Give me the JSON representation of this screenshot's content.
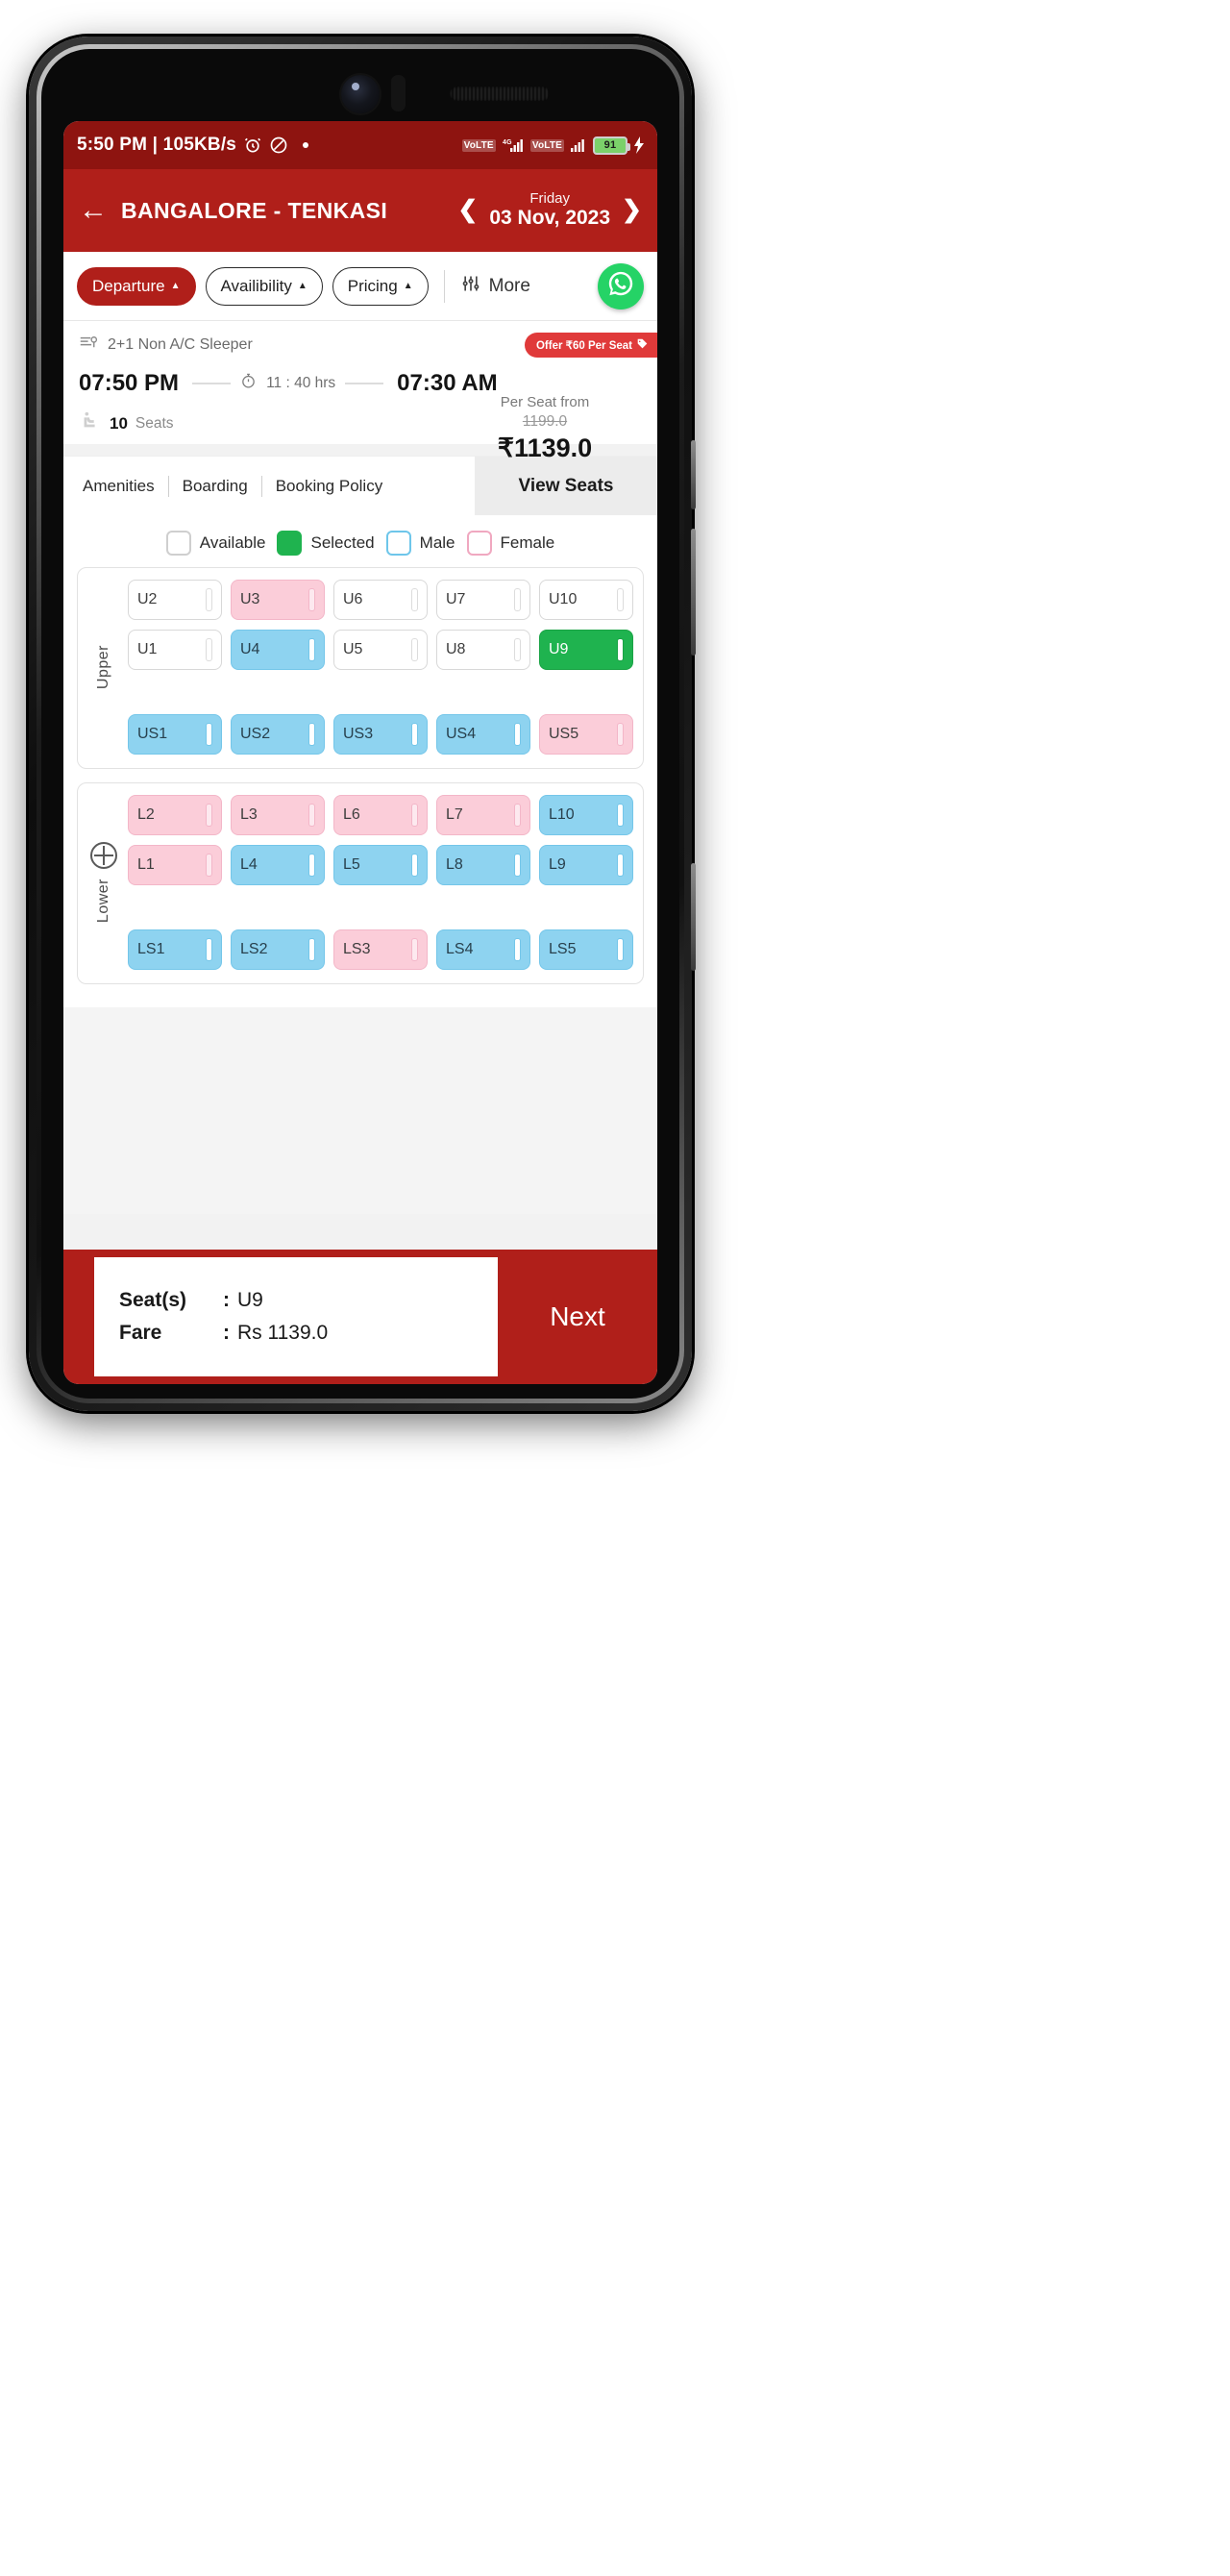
{
  "status_bar": {
    "time_and_speed": "5:50 PM | 105KB/s",
    "alarm_icon": "alarm-clock-icon",
    "dnd_icon": "do-not-disturb-icon",
    "network_badge_1": "VoLTE",
    "network_type": "4G",
    "network_badge_2": "VoLTE",
    "battery_percent": "91",
    "charging_icon": "charging-bolt-icon"
  },
  "header": {
    "back_icon": "back-arrow-icon",
    "route_title": "BANGALORE - TENKASI",
    "prev_icon": "chevron-left-icon",
    "next_icon": "chevron-right-icon",
    "day_label": "Friday",
    "date_label": "03 Nov, 2023"
  },
  "filters": {
    "chips": [
      {
        "label": "Departure",
        "active": true
      },
      {
        "label": "Availibility",
        "active": false
      },
      {
        "label": "Pricing",
        "active": false
      }
    ],
    "more_label": "More",
    "more_icon": "filter-sliders-icon",
    "whatsapp_icon": "whatsapp-icon"
  },
  "bus": {
    "bus_icon": "bus-icon",
    "bus_type": "2+1 Non A/C Sleeper",
    "offer_badge": "Offer ₹60 Per Seat",
    "offer_tag_icon": "tag-icon",
    "departure_time": "07:50 PM",
    "duration_icon": "stopwatch-icon",
    "duration": "11 : 40 hrs",
    "arrival_time": "07:30 AM",
    "seat_icon": "seat-icon",
    "seats_count": "10",
    "seats_word": "Seats",
    "price_label": "Per Seat from",
    "price_original": "1199.0",
    "price_current": "₹1139.0"
  },
  "tabs": {
    "links": [
      "Amenities",
      "Boarding",
      "Booking Policy"
    ],
    "view_seats": "View Seats"
  },
  "legend": [
    {
      "label": "Available",
      "state": "available"
    },
    {
      "label": "Selected",
      "state": "selected"
    },
    {
      "label": "Male",
      "state": "male"
    },
    {
      "label": "Female",
      "state": "female"
    }
  ],
  "decks": [
    {
      "name": "Upper",
      "has_wheel": false,
      "rows": [
        [
          {
            "id": "U2",
            "state": "available"
          },
          {
            "id": "U3",
            "state": "female"
          },
          {
            "id": "U6",
            "state": "available"
          },
          {
            "id": "U7",
            "state": "available"
          },
          {
            "id": "U10",
            "state": "available"
          }
        ],
        [
          {
            "id": "U1",
            "state": "available"
          },
          {
            "id": "U4",
            "state": "male"
          },
          {
            "id": "U5",
            "state": "available"
          },
          {
            "id": "U8",
            "state": "available"
          },
          {
            "id": "U9",
            "state": "selected"
          }
        ],
        [
          {
            "id": "US1",
            "state": "male"
          },
          {
            "id": "US2",
            "state": "male"
          },
          {
            "id": "US3",
            "state": "male"
          },
          {
            "id": "US4",
            "state": "male"
          },
          {
            "id": "US5",
            "state": "female"
          }
        ]
      ]
    },
    {
      "name": "Lower",
      "has_wheel": true,
      "wheel_icon": "steering-wheel-icon",
      "rows": [
        [
          {
            "id": "L2",
            "state": "female"
          },
          {
            "id": "L3",
            "state": "female"
          },
          {
            "id": "L6",
            "state": "female"
          },
          {
            "id": "L7",
            "state": "female"
          },
          {
            "id": "L10",
            "state": "male"
          }
        ],
        [
          {
            "id": "L1",
            "state": "female"
          },
          {
            "id": "L4",
            "state": "male"
          },
          {
            "id": "L5",
            "state": "male"
          },
          {
            "id": "L8",
            "state": "male"
          },
          {
            "id": "L9",
            "state": "male"
          }
        ],
        [
          {
            "id": "LS1",
            "state": "male"
          },
          {
            "id": "LS2",
            "state": "male"
          },
          {
            "id": "LS3",
            "state": "female"
          },
          {
            "id": "LS4",
            "state": "male"
          },
          {
            "id": "LS5",
            "state": "male"
          }
        ]
      ]
    }
  ],
  "bottom": {
    "seats_key": "Seat(s)",
    "seats_value": "U9",
    "fare_key": "Fare",
    "fare_value": "Rs 1139.0",
    "next_label": "Next"
  },
  "colors": {
    "brand_red": "#b01f1a",
    "status_red": "#8e1410",
    "selected_green": "#1fb34f",
    "male_blue": "#8ed3f0",
    "female_pink": "#fbcdd9",
    "whatsapp_green": "#25d366"
  }
}
